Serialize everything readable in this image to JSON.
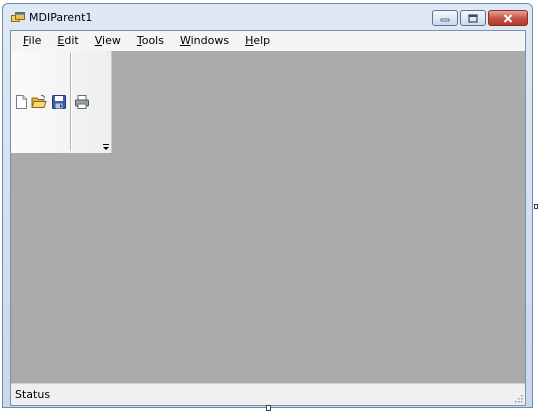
{
  "window": {
    "title": "MDIParent1",
    "icon": "mdi-parent-app-icon"
  },
  "caption_buttons": [
    "minimize-icon",
    "maximize-icon",
    "close-icon"
  ],
  "menu": {
    "items": [
      {
        "label": "File",
        "mnemonic": "F",
        "rest": "ile"
      },
      {
        "label": "Edit",
        "mnemonic": "E",
        "rest": "dit"
      },
      {
        "label": "View",
        "mnemonic": "V",
        "rest": "iew"
      },
      {
        "label": "Tools",
        "mnemonic": "T",
        "rest": "ools"
      },
      {
        "label": "Windows",
        "mnemonic": "W",
        "rest": "indows"
      },
      {
        "label": "Help",
        "mnemonic": "H",
        "rest": "elp"
      }
    ]
  },
  "toolbar": {
    "buttons": [
      "new-document-icon",
      "open-folder-icon",
      "save-disk-icon",
      "print-icon"
    ],
    "overflow": "toolbar-overflow-icon"
  },
  "status": {
    "label": "Status"
  },
  "colors": {
    "mdi_background": "#ababab",
    "menubar": "#f5f5f5",
    "statusbar": "#efefef",
    "frame": "#c9d9ec",
    "close_button": "#c45142"
  }
}
